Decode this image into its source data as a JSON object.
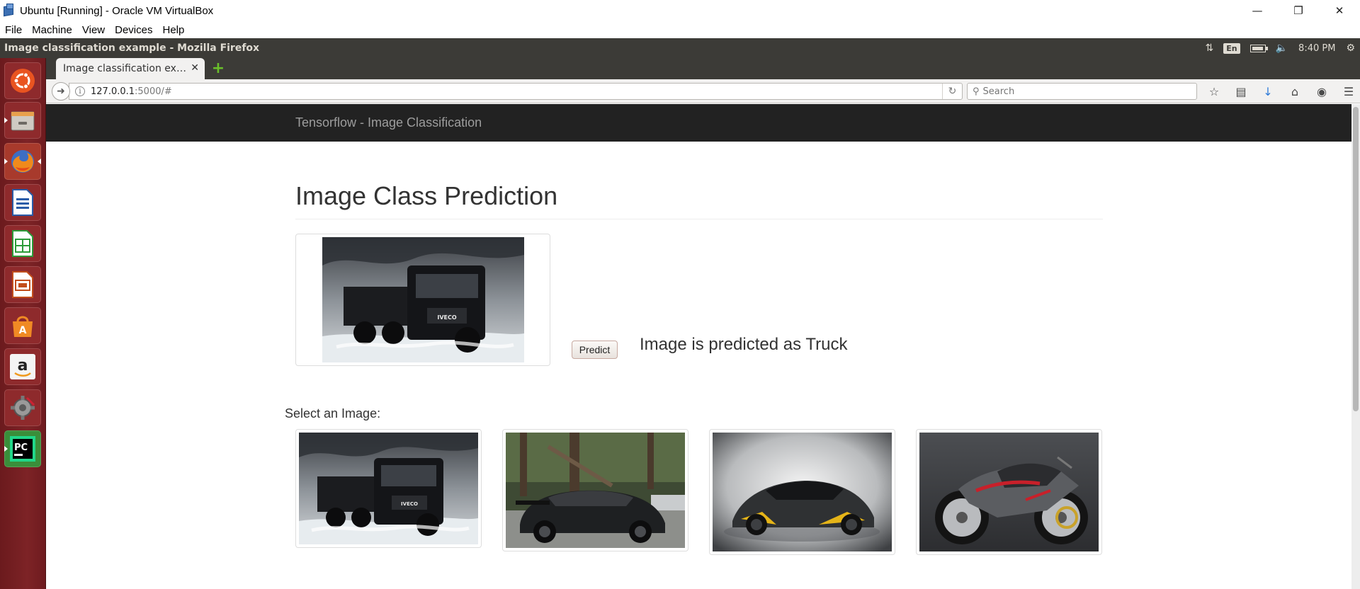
{
  "host_window": {
    "title": "Ubuntu [Running] - Oracle VM VirtualBox",
    "menu": [
      "File",
      "Machine",
      "View",
      "Devices",
      "Help"
    ]
  },
  "ubuntu_panel": {
    "window_title": "Image classification example - Mozilla Firefox",
    "keyboard_layout": "En",
    "time": "8:40 PM"
  },
  "launcher": {
    "items": [
      "ubuntu-dash",
      "files",
      "firefox",
      "writer",
      "calc",
      "impress",
      "software-center",
      "amazon",
      "system-settings",
      "pycharm"
    ]
  },
  "browser": {
    "tab_title": "Image classification ex…",
    "url_host": "127.0.0.1",
    "url_rest": ":5000/#",
    "search_placeholder": "Search"
  },
  "page": {
    "brand": "Tensorflow - Image Classification",
    "heading": "Image Class Prediction",
    "predict_label": "Predict",
    "prediction": "Image is predicted as Truck",
    "select_label": "Select an Image:",
    "thumbnails": [
      "truck",
      "sports-car-rear",
      "sports-car-front",
      "motorcycle"
    ]
  },
  "colors": {
    "navbar": "#222222",
    "brand_text": "#9d9d9d",
    "launcher": "#7a1f22",
    "ubuntu_panel": "#3c3b37"
  }
}
